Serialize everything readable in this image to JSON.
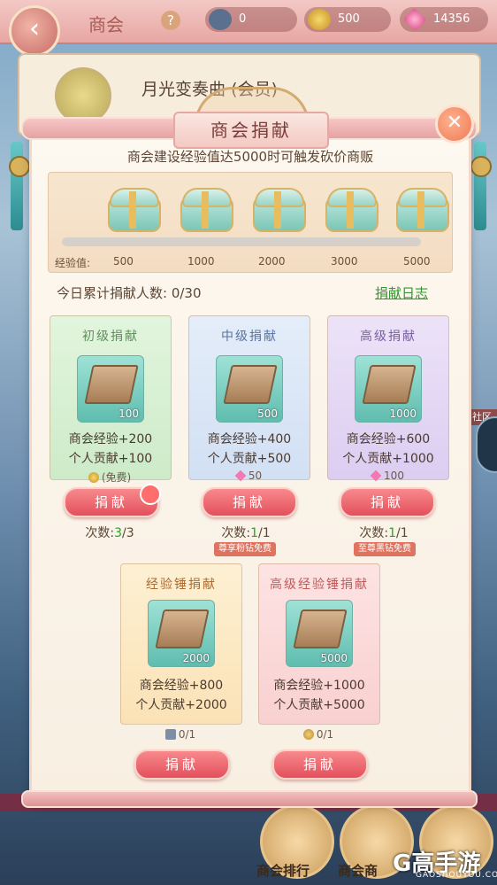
{
  "background": {
    "title": "商会",
    "help_icon": "?",
    "resources": [
      {
        "icon": "hammer-icon",
        "value": "0"
      },
      {
        "icon": "gold-coin-icon",
        "value": "500"
      },
      {
        "icon": "diamond-icon",
        "value": "14356"
      }
    ],
    "player_name": "月光变奏曲",
    "player_suffix": "(会员)",
    "side_tag": "社区",
    "bottom_labels": [
      "商会排行",
      "商会商"
    ]
  },
  "dialog": {
    "title": "商会捐献",
    "close_icon": "close-icon",
    "subtitle": "商会建设经验值达5000时可触发砍价商贩",
    "exp_label": "经验值:",
    "milestones": [
      "500",
      "1000",
      "2000",
      "3000",
      "5000"
    ],
    "exp_progress": 0,
    "donors_text": "今日累计捐献人数: 0/30",
    "log_link": "捐献日志"
  },
  "cards": [
    {
      "title": "初级捐献",
      "qty": "100",
      "line1": "商会经验+200",
      "line2": "个人贡献+100",
      "cost_icon": "gold-coin-icon",
      "cost": "(免费)",
      "button": "捐献",
      "count_label": "次数:",
      "count_cur": "3",
      "count_total": "/3",
      "tag": ""
    },
    {
      "title": "中级捐献",
      "qty": "500",
      "line1": "商会经验+400",
      "line2": "个人贡献+500",
      "cost_icon": "diamond-icon",
      "cost": "50",
      "button": "捐献",
      "count_label": "次数:",
      "count_cur": "1",
      "count_total": "/1",
      "tag": "尊享粉钻免费"
    },
    {
      "title": "高级捐献",
      "qty": "1000",
      "line1": "商会经验+600",
      "line2": "个人贡献+1000",
      "cost_icon": "diamond-icon",
      "cost": "100",
      "button": "捐献",
      "count_label": "次数:",
      "count_cur": "1",
      "count_total": "/1",
      "tag": "至尊黑钻免费"
    },
    {
      "title": "经验锤捐献",
      "qty": "2000",
      "line1": "商会经验+800",
      "line2": "个人贡献+2000",
      "cost_icon": "hammer-icon",
      "cost": "0/1",
      "button": "捐献"
    },
    {
      "title": "高级经验锤捐献",
      "qty": "5000",
      "line1": "商会经验+1000",
      "line2": "个人贡献+5000",
      "cost_icon": "medal-icon",
      "cost": "0/1",
      "button": "捐献"
    }
  ],
  "colors": {
    "card_green": "#d9f1d6",
    "card_blue": "#dde8f8",
    "card_purple": "#e6dcf6",
    "card_orange": "#fde9c6",
    "card_pink": "#fbdede",
    "button": "#e44f5c",
    "link": "#2c9a2c"
  },
  "watermark": {
    "logo": "G高手游",
    "sub": "GAOSHOUYOU.COM"
  }
}
